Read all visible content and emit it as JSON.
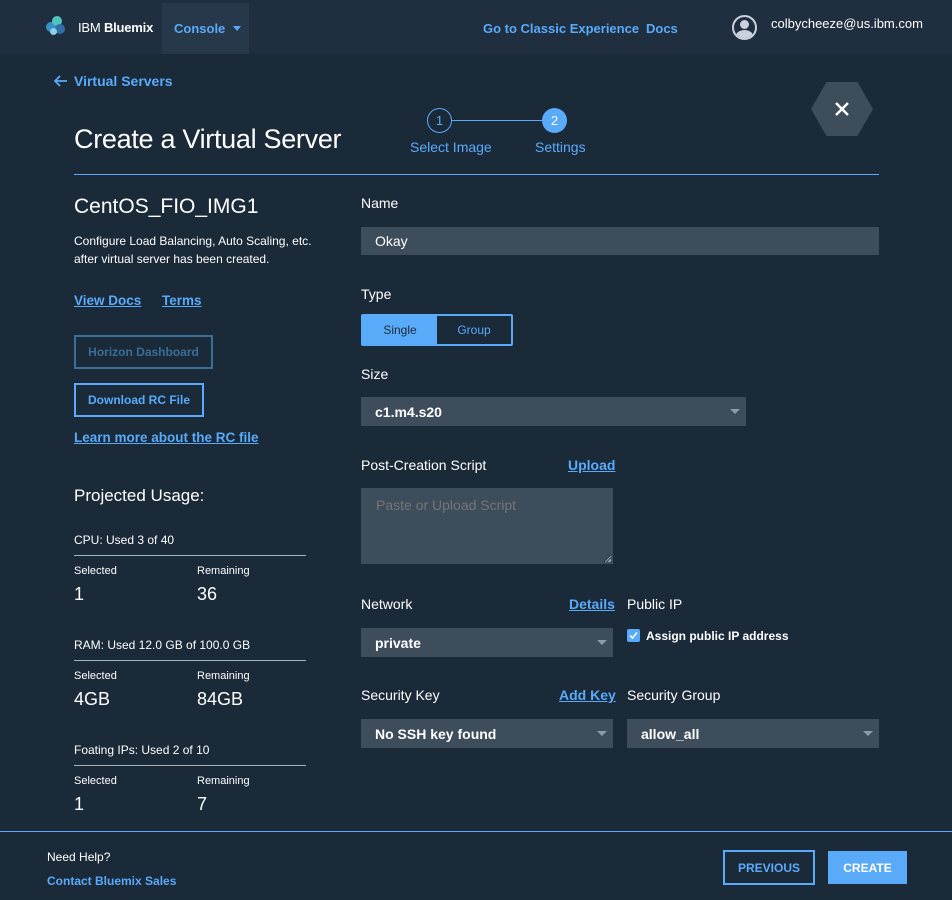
{
  "topbar": {
    "brand_prefix": "IBM",
    "brand_name": "Bluemix",
    "console_label": "Console",
    "classic_link": "Go to Classic Experience",
    "docs_link": "Docs",
    "user_email": "colbycheeze@us.ibm.com"
  },
  "nav": {
    "back_label": "Virtual Servers"
  },
  "page": {
    "title": "Create a Virtual Server"
  },
  "stepper": {
    "steps": [
      {
        "number": "1",
        "label": "Select Image"
      },
      {
        "number": "2",
        "label": "Settings"
      }
    ],
    "active_step": 2
  },
  "sidebar": {
    "image_name": "CentOS_FIO_IMG1",
    "description": "Configure Load Balancing, Auto Scaling, etc. after virtual server has been created.",
    "view_docs": "View Docs",
    "terms": "Terms",
    "horizon_button": "Horizon Dashboard",
    "download_button": "Download RC File",
    "learn_more": "Learn more about the RC file",
    "usage_title": "Projected Usage:",
    "usage": [
      {
        "heading": "CPU: Used 3 of 40",
        "selected_label": "Selected",
        "selected": "1",
        "remaining_label": "Remaining",
        "remaining": "36"
      },
      {
        "heading": "RAM: Used 12.0 GB of 100.0 GB",
        "selected_label": "Selected",
        "selected": "4GB",
        "remaining_label": "Remaining",
        "remaining": "84GB"
      },
      {
        "heading": "Foating IPs: Used 2 of 10",
        "selected_label": "Selected",
        "selected": "1",
        "remaining_label": "Remaining",
        "remaining": "7"
      }
    ]
  },
  "form": {
    "name_label": "Name",
    "name_value": "Okay",
    "type_label": "Type",
    "type_options": [
      "Single",
      "Group"
    ],
    "type_selected": "Single",
    "size_label": "Size",
    "size_value": "c1.m4.s20",
    "script_label": "Post-Creation Script",
    "upload_link": "Upload",
    "script_placeholder": "Paste or Upload Script",
    "network_label": "Network",
    "details_link": "Details",
    "network_value": "private",
    "public_ip_label": "Public IP",
    "public_ip_checkbox": "Assign public IP address",
    "public_ip_checked": true,
    "security_key_label": "Security Key",
    "add_key_link": "Add Key",
    "security_key_value": "No SSH key found",
    "security_group_label": "Security Group",
    "security_group_value": "allow_all"
  },
  "footer": {
    "help_title": "Need Help?",
    "help_link": "Contact Bluemix Sales",
    "previous_button": "PREVIOUS",
    "create_button": "CREATE"
  },
  "colors": {
    "background": "#1a2a39",
    "accent": "#5aaafa",
    "input_bg": "#3d4d5c"
  }
}
